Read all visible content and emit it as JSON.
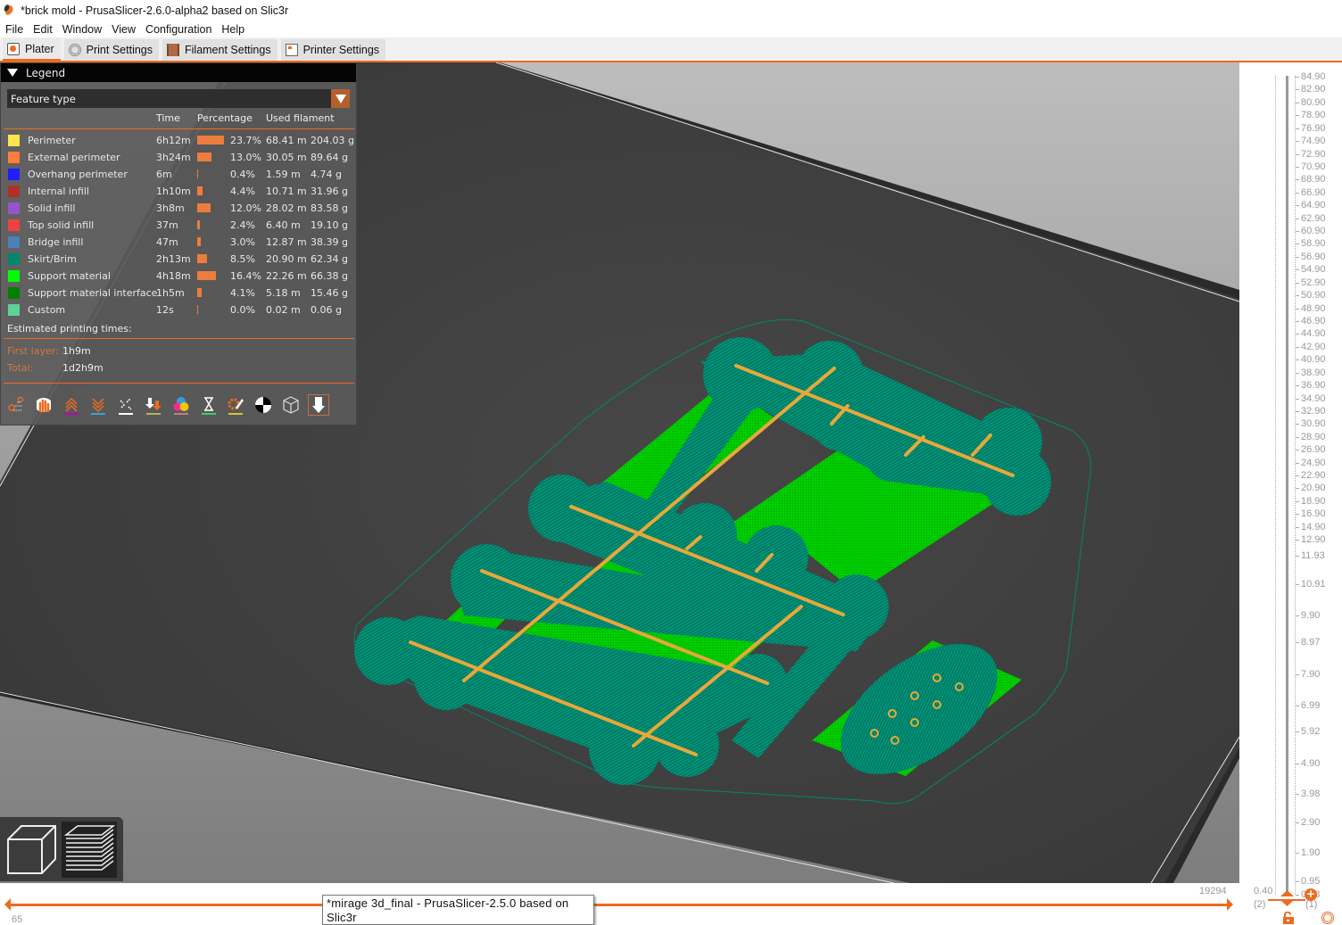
{
  "window": {
    "title": "*brick mold - PrusaSlicer-2.6.0-alpha2 based on Slic3r",
    "app_icon": "prusaslicer-icon"
  },
  "menu": [
    "File",
    "Edit",
    "Window",
    "View",
    "Configuration",
    "Help"
  ],
  "tabs": [
    {
      "label": "Plater",
      "icon": "plater-icon",
      "active": true
    },
    {
      "label": "Print Settings",
      "icon": "print-settings-icon",
      "active": false
    },
    {
      "label": "Filament Settings",
      "icon": "filament-icon",
      "active": false
    },
    {
      "label": "Printer Settings",
      "icon": "printer-icon",
      "active": false
    }
  ],
  "legend": {
    "title": "Legend",
    "view_type": "Feature type",
    "columns": {
      "time": "Time",
      "percentage": "Percentage",
      "used_filament": "Used filament"
    },
    "rows": [
      {
        "name": "Perimeter",
        "color": "#FFE64D",
        "time": "6h12m",
        "percent": "23.7%",
        "pct_value": 23.7,
        "length": "68.41 m",
        "weight": "204.03 g"
      },
      {
        "name": "External perimeter",
        "color": "#FF7D38",
        "time": "3h24m",
        "percent": "13.0%",
        "pct_value": 13.0,
        "length": "30.05 m",
        "weight": "89.64 g"
      },
      {
        "name": "Overhang perimeter",
        "color": "#1F1FFF",
        "time": "6m",
        "percent": "0.4%",
        "pct_value": 0.4,
        "length": "1.59 m",
        "weight": "4.74 g"
      },
      {
        "name": "Internal infill",
        "color": "#B03029",
        "time": "1h10m",
        "percent": "4.4%",
        "pct_value": 4.4,
        "length": "10.71 m",
        "weight": "31.96 g"
      },
      {
        "name": "Solid infill",
        "color": "#9654CC",
        "time": "3h8m",
        "percent": "12.0%",
        "pct_value": 12.0,
        "length": "28.02 m",
        "weight": "83.58 g"
      },
      {
        "name": "Top solid infill",
        "color": "#F04040",
        "time": "37m",
        "percent": "2.4%",
        "pct_value": 2.4,
        "length": "6.40 m",
        "weight": "19.10 g"
      },
      {
        "name": "Bridge infill",
        "color": "#4D80BA",
        "time": "47m",
        "percent": "3.0%",
        "pct_value": 3.0,
        "length": "12.87 m",
        "weight": "38.39 g"
      },
      {
        "name": "Skirt/Brim",
        "color": "#00876E",
        "time": "2h13m",
        "percent": "8.5%",
        "pct_value": 8.5,
        "length": "20.90 m",
        "weight": "62.34 g"
      },
      {
        "name": "Support material",
        "color": "#00FF00",
        "time": "4h18m",
        "percent": "16.4%",
        "pct_value": 16.4,
        "length": "22.26 m",
        "weight": "66.38 g"
      },
      {
        "name": "Support material interface",
        "color": "#008000",
        "time": "1h5m",
        "percent": "4.1%",
        "pct_value": 4.1,
        "length": "5.18 m",
        "weight": "15.46 g"
      },
      {
        "name": "Custom",
        "color": "#5ED194",
        "time": "12s",
        "percent": "0.0%",
        "pct_value": 0.0,
        "length": "0.02 m",
        "weight": "0.06 g"
      }
    ],
    "estimated_title": "Estimated printing times:",
    "first_layer_label": "First layer:",
    "first_layer_value": "1h9m",
    "total_label": "Total:",
    "total_value": "1d2h9m",
    "toolbar_icons": [
      "travel-icon",
      "wipe-icon",
      "retractions-icon",
      "deretractions-icon",
      "seams-icon",
      "tool-changes-icon",
      "color-changes-icon",
      "pause-prints-icon",
      "custom-gcodes-icon",
      "center-of-gravity-icon",
      "shells-icon",
      "tool-marker-icon"
    ]
  },
  "view_toggles": [
    "3d-view-icon",
    "preview-layers-icon"
  ],
  "vertical_slider": {
    "labels": [
      "84.90",
      "82.90",
      "80.90",
      "78.90",
      "76.90",
      "74.90",
      "72.90",
      "70.90",
      "68.90",
      "66.90",
      "64.90",
      "62.90",
      "60.90",
      "58.90",
      "56.90",
      "54.90",
      "52.90",
      "50.90",
      "48.90",
      "46.90",
      "44.90",
      "42.90",
      "40.90",
      "38.90",
      "36.90",
      "34.90",
      "32.90",
      "30.90",
      "28.90",
      "26.90",
      "24.90",
      "22.90",
      "20.90",
      "18.90",
      "16.90",
      "14.90",
      "12.90",
      "11.93",
      "10.91",
      "9.90",
      "8.97",
      "7.90",
      "6.99",
      "5.92",
      "4.90",
      "3.98",
      "2.90",
      "1.90",
      "0.95",
      "0.28"
    ],
    "lower_value": "0.40",
    "lower_index": "(2)",
    "upper_index": "(1)",
    "add_color_change": "+"
  },
  "horizontal_slider": {
    "min_value": "65",
    "max_value": "19294"
  },
  "tooltip": {
    "text": "*mirage 3d_final - PrusaSlicer-2.5.0 based on Slic3r"
  },
  "colors": {
    "accent": "#ED6B21",
    "bed": "#3C3C3C",
    "skirt_brim": "#00876E",
    "support": "#00D400",
    "perimeter": "#E8B440"
  }
}
